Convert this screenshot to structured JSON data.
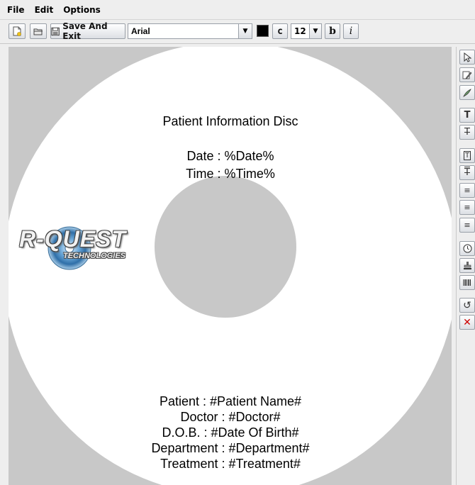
{
  "menu": {
    "file": "File",
    "edit": "Edit",
    "options": "Options"
  },
  "toolbar": {
    "save_exit_label": "Save And Exit",
    "font_value": "Arial",
    "color_swatch": "#000000",
    "center_label": "c",
    "font_size_value": "12",
    "bold_label": "b",
    "italic_label": "i"
  },
  "disc": {
    "title": "Patient Information Disc",
    "date_line": "Date : %Date%",
    "time_line": "Time : %Time%",
    "patient_line": "Patient : #Patient Name#",
    "doctor_line": "Doctor : #Doctor#",
    "dob_line": "D.O.B. : #Date Of Birth#",
    "department_line": "Department : #Department#",
    "treatment_line": "Treatment : #Treatment#",
    "logo_word": "R-QUEST",
    "logo_sub": "TECHNOLOGIES"
  },
  "colors": {
    "canvas_bg": "#c8c8c8",
    "disc": "#ffffff",
    "delete_icon": "#cc0000"
  },
  "icons": [
    "select-arrow-icon",
    "edit-icon",
    "paint-icon",
    "text-icon",
    "text-strike-icon",
    "text-box-icon",
    "text-overline-icon",
    "align-left-icon",
    "align-center-icon",
    "align-right-icon",
    "clock-icon",
    "stamp-icon",
    "barcode-icon",
    "rotate-icon",
    "delete-icon"
  ]
}
